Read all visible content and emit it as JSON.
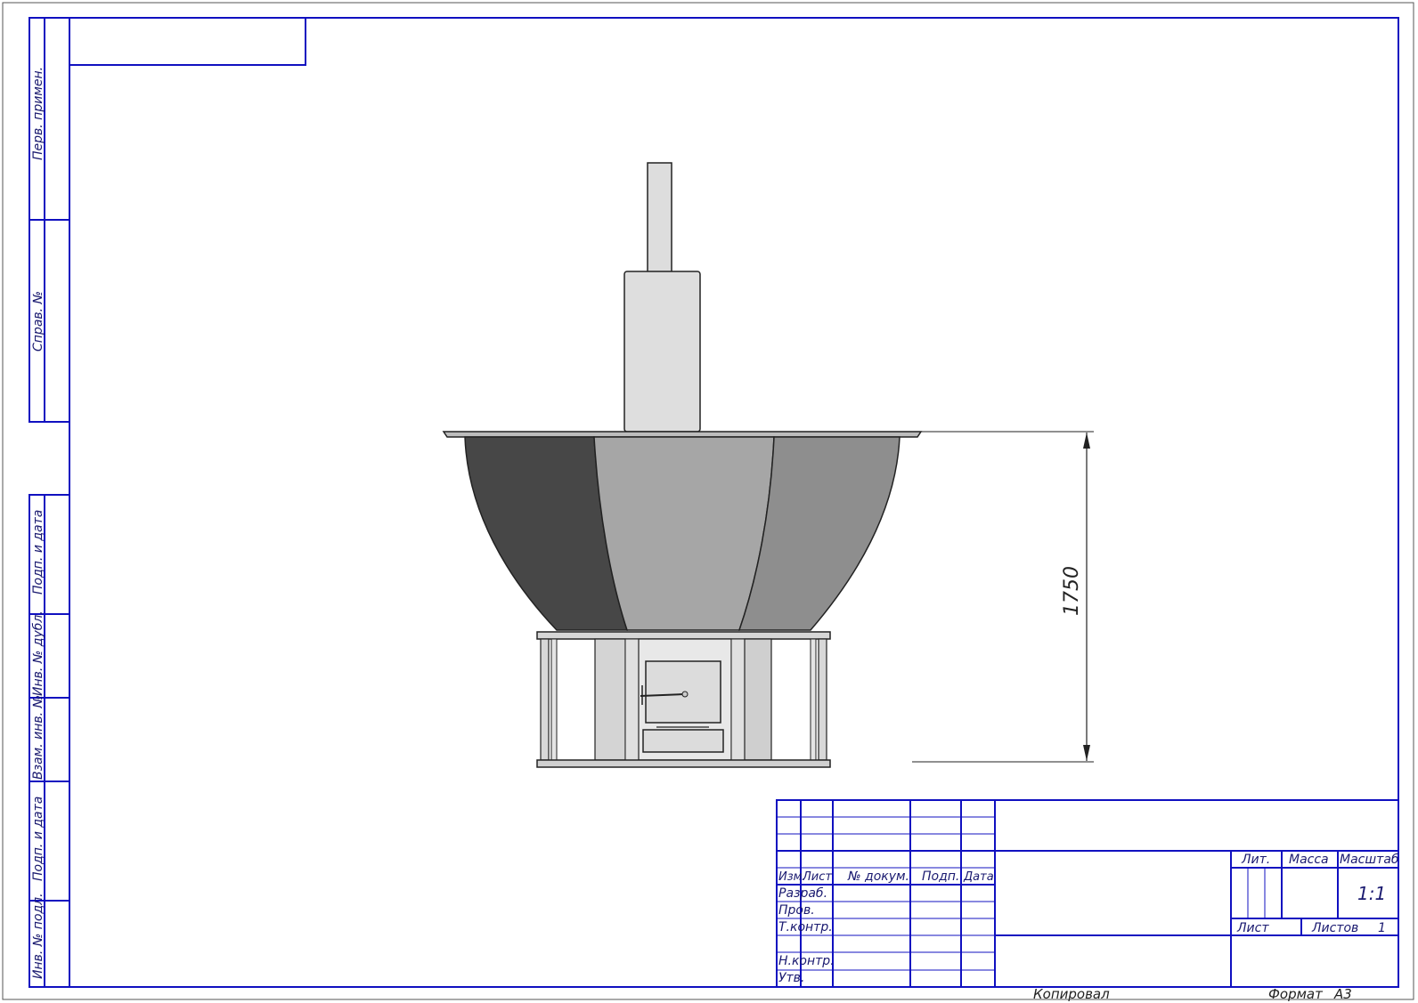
{
  "sheet": {
    "format_label": "Формат",
    "format_value": "A3",
    "copied_label": "Копировал"
  },
  "side_labels": {
    "perv_primen": "Перв. примен.",
    "sprav_no": "Справ. №",
    "podp_data_top": "Подп. и дата",
    "inv_dubl": "Инв. № дубл.",
    "vzam_inv": "Взам. инв. №",
    "podp_data_bottom": "Подп. и дата",
    "inv_podl": "Инв. № подл."
  },
  "title_block": {
    "headers": {
      "izm": "Изм.",
      "list": "Лист",
      "no_dokum": "№ докум.",
      "podp": "Подп.",
      "data": "Дата"
    },
    "roles": {
      "razrab": "Разраб.",
      "prov": "Пров.",
      "t_kontr": "Т.контр.",
      "n_kontr": "Н.контр.",
      "utv": "Утв."
    },
    "lit_label": "Лит.",
    "massa_label": "Масса",
    "masshtab_label": "Масштаб",
    "scale_value": "1:1",
    "sheet_label": "Лист",
    "sheets_label": "Листов",
    "sheets_count": "1"
  },
  "drawing": {
    "dimension_height": "1750",
    "colors": {
      "frame": "#1010c0",
      "panel_dark": "#474747",
      "panel_mid": "#a6a6a6",
      "panel_right": "#8e8e8e",
      "light_metal": "#dcdcdc"
    }
  }
}
